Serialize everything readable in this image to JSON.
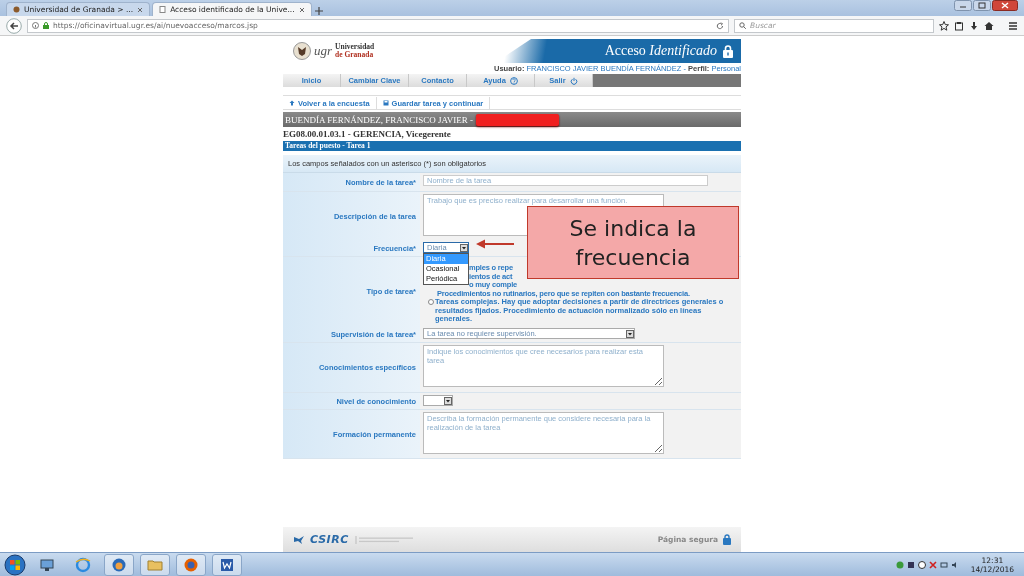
{
  "browser": {
    "tabs": [
      {
        "label": "Universidad de Granada > ...",
        "selected": false
      },
      {
        "label": "Acceso identificado de la Unive...",
        "selected": true
      }
    ],
    "url": "https://oficinavirtual.ugr.es/ai/nuevoacceso/marcos.jsp",
    "search": {
      "placeholder": "Buscar"
    }
  },
  "header": {
    "logo": {
      "mark": "ugr",
      "line1": "Universidad",
      "line2": "de Granada"
    },
    "title": "Acceso *Identificado*",
    "user_line": "**Usuario:** FRANCISCO JAVIER BUENDÍA FERNÁNDEZ - **Perfil:** Personal"
  },
  "menu": [
    {
      "label": "Inicio"
    },
    {
      "label": "Cambiar Clave"
    },
    {
      "label": "Contacto"
    },
    {
      "label": "Ayuda"
    },
    {
      "label": "Salir"
    }
  ],
  "toolbar": [
    {
      "label": "Volver a la encuesta"
    },
    {
      "label": "Guardar tarea y continuar"
    }
  ],
  "person": {
    "name": "BUENDÍA FERNÁNDEZ, FRANCISCO JAVIER -",
    "redacted": true
  },
  "position": "EG08.00.01.03.1 - GERENCIA, Vicegerente",
  "section_title": "Tareas del puesto - Tarea 1",
  "form": {
    "notice": "Los campos señalados con un asterisco (*) son obligatorios",
    "rows": [
      {
        "kind": "text",
        "label": "Nombre de la tarea*",
        "placeholder": "Nombre de la tarea"
      },
      {
        "kind": "textarea",
        "label": "Descripción de la tarea",
        "placeholder": "Trabajo que es preciso realizar para desarrollar una función."
      },
      {
        "kind": "select",
        "label": "Frecuencia*",
        "value": "Diaria",
        "expanded": true,
        "options": [
          {
            "label": "Diaria",
            "selected": true
          },
          {
            "label": "Ocasional",
            "selected": false
          },
          {
            "label": "Periódica",
            "selected": false
          }
        ]
      },
      {
        "kind": "radio",
        "label": "Tipo de tarea*",
        "options": [
          {
            "visible_lines": [
              "mples o repe",
              "ientos de act"
            ]
          },
          {
            "visible_lines": [
              "o muy comple",
              "Procedimientos no rutinarios, pero que se repiten con bastante frecuencia."
            ]
          },
          {
            "text": "Tareas complejas. Hay que adoptar decisiones a partir de directrices generales o resultados fijados. Procedimiento de actuación normalizado sólo en líneas generales.",
            "selected": false
          }
        ]
      },
      {
        "kind": "select",
        "label": "Supervisión de la tarea*",
        "value": "La tarea no requiere supervisión.",
        "expanded": false
      },
      {
        "kind": "textarea",
        "label": "Conocimientos específicos",
        "placeholder": "Indique los conocimientos que cree necesarios para realizar esta tarea"
      },
      {
        "kind": "select",
        "label": "Nivel de conocimiento",
        "expanded": false
      },
      {
        "kind": "textarea",
        "label": "Formación permanente",
        "placeholder": "Describa la formación permanente que considere necesaria para la realización de la tarea"
      }
    ]
  },
  "callout": "Se indica la frecuencia",
  "footer": {
    "logo": "CSIRC",
    "secure": "Página segura"
  },
  "taskbar": {
    "time": "12:31",
    "date": "14/12/2016"
  }
}
